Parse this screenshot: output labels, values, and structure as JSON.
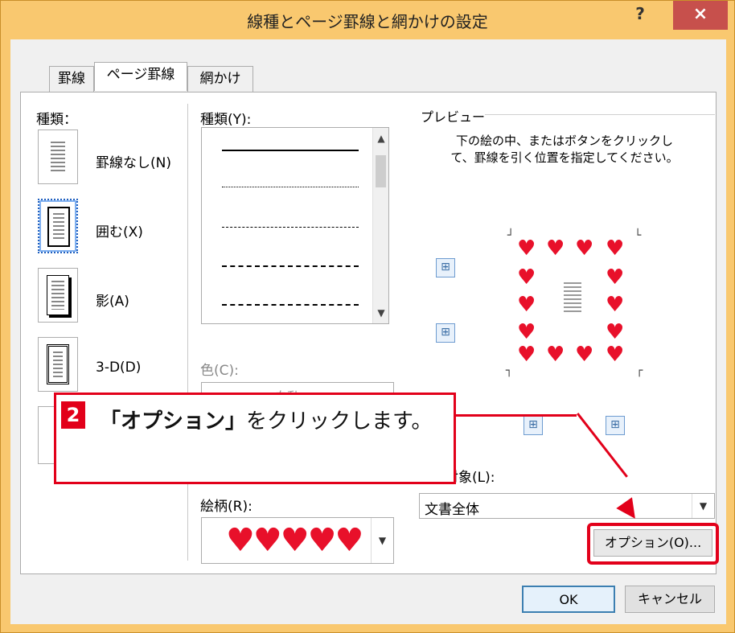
{
  "window": {
    "title": "線種とページ罫線と網かけの設定",
    "help_label": "?",
    "close_label": "×"
  },
  "tabs": [
    {
      "label": "罫線"
    },
    {
      "label": "ページ罫線"
    },
    {
      "label": "網かけ"
    }
  ],
  "setting": {
    "label": "種類：",
    "options": [
      {
        "label": "罫線なし(N)"
      },
      {
        "label": "囲む(X)"
      },
      {
        "label": "影(A)"
      },
      {
        "label": "3-D(D)"
      }
    ]
  },
  "style": {
    "label": "種類(Y):",
    "color_label": "色(C):",
    "color_value": "自動",
    "art_label": "絵柄(R):",
    "art_hearts": "♥♥♥♥♥"
  },
  "preview": {
    "label": "プレビュー",
    "instruction": "下の絵の中、またはボタンをクリックして、罫線を引く位置を指定してください。",
    "apply_label": "設定対象(L):",
    "apply_value": "文書全体",
    "options_button": "オプション(O)..."
  },
  "footer": {
    "ok": "OK",
    "cancel": "キャンセル"
  },
  "callout": {
    "step": "2",
    "quote_open": "「",
    "target": "オプション",
    "quote_close": "」",
    "text": "をクリックします。"
  },
  "colors": {
    "accent_red": "#e2001a",
    "heart": "#e8102a",
    "window_frame": "#f9c86f"
  }
}
